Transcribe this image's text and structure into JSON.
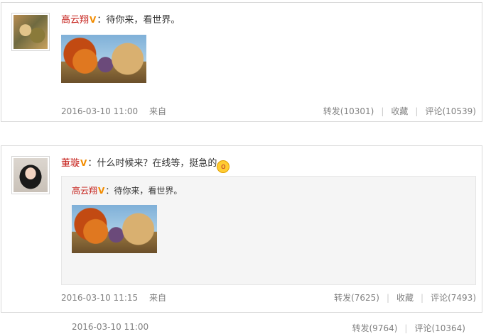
{
  "post1": {
    "user": "高云翔",
    "colon": "：",
    "text": "待你来，看世界。",
    "date": "2016-03-10 11:00",
    "source": "来自",
    "repost_label": "转发(10301)",
    "fav_label": "收藏",
    "comment_label": "评论(10539)"
  },
  "post2": {
    "user": "董璇",
    "colon": "：",
    "text": "什么时候来？在线等，挺急的",
    "date": "2016-03-10 11:15",
    "source": "来自",
    "repost_label": "转发(7625)",
    "fav_label": "收藏",
    "comment_label": "评论(7493)",
    "quoted": {
      "user": "高云翔",
      "colon": "：",
      "text": "待你来，看世界。",
      "date": "2016-03-10 11:00",
      "repost_label": "转发(9764)",
      "comment_label": "评论(10364)"
    }
  },
  "badge": "V",
  "icons": {
    "verified": "verified-v-icon",
    "emoji": "shocked-face-emoji-icon"
  },
  "colors": {
    "username": "#c41a14",
    "verified_badge": "#f28c00",
    "meta_text": "#808080",
    "quote_bg": "#f5f5f5"
  }
}
